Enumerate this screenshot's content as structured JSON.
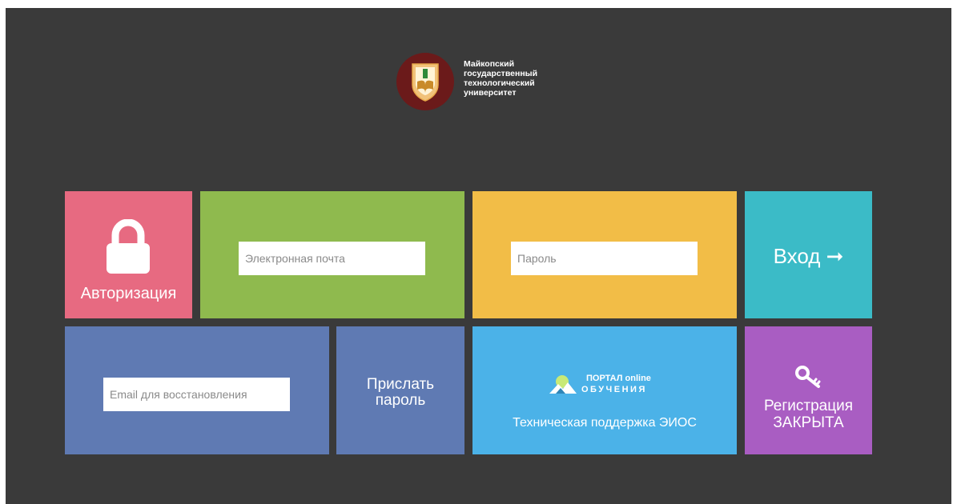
{
  "logo": {
    "name": "Майкопский\nгосударственный\nтехнологический\nуниверситет",
    "emblem": "university-emblem-icon"
  },
  "auth": {
    "label": "Авторизация",
    "icon": "lock-icon",
    "color": "#e76a81"
  },
  "email": {
    "placeholder": "Электронная почта",
    "value": "",
    "color": "#8fba4e"
  },
  "password": {
    "placeholder": "Пароль",
    "value": "",
    "color": "#f2bd47"
  },
  "login": {
    "label": "Вход ➞",
    "color": "#3bbbc7"
  },
  "recover": {
    "placeholder": "Email для восстановления",
    "value": "",
    "color": "#5f7ab3"
  },
  "send_password": {
    "label": "Прислать\nпароль",
    "color": "#5f7ab3"
  },
  "support": {
    "portal_line1": "ПОРТАЛ online",
    "portal_line2": "ОБУЧЕНИЯ",
    "label": "Техническая поддержка ЭИОС",
    "icon": "mountain-sun-icon",
    "color": "#4bb2e8"
  },
  "register": {
    "label": "Регистрация\nЗАКРЫТА",
    "icon": "key-icon",
    "color": "#a95dc2"
  }
}
